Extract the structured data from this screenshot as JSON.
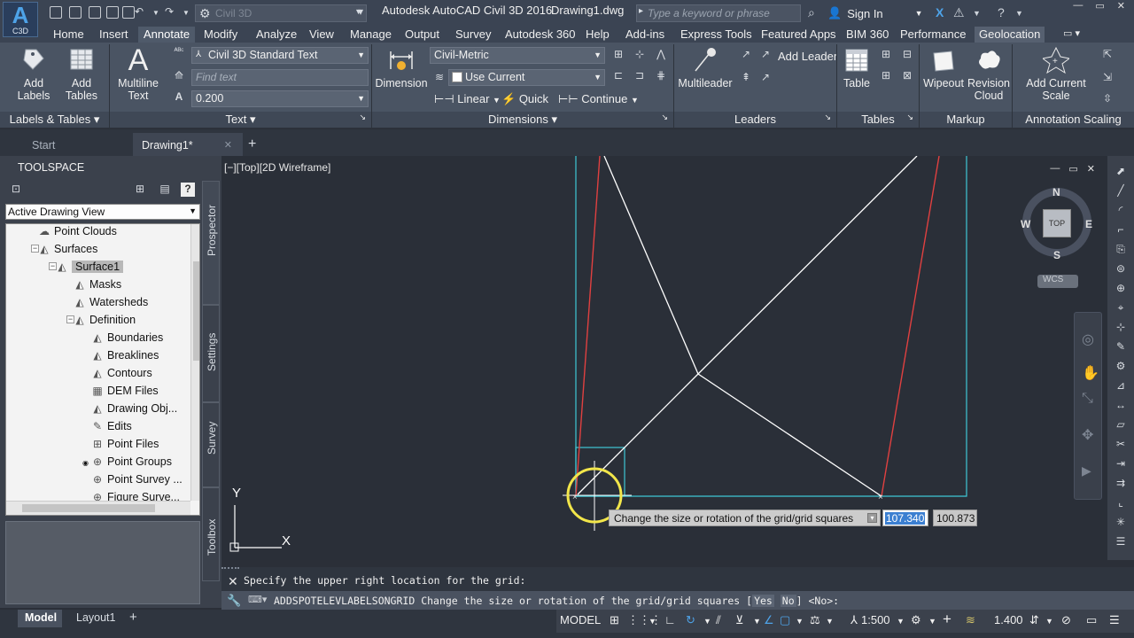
{
  "titlebar": {
    "app_title": "Autodesk AutoCAD Civil 3D 2016",
    "doc_title": "Drawing1.dwg",
    "workspace": "Civil 3D",
    "search_placeholder": "Type a keyword or phrase",
    "signin": "Sign In",
    "logo_letter": "A",
    "logo_sub": "C3D"
  },
  "ribbon_tabs": [
    "Home",
    "Insert",
    "Annotate",
    "Modify",
    "Analyze",
    "View",
    "Manage",
    "Output",
    "Survey",
    "Autodesk 360",
    "Help",
    "Add-ins",
    "Express Tools",
    "Featured Apps",
    "BIM 360",
    "Performance",
    "Geolocation"
  ],
  "active_ribbon_tab": "Annotate",
  "ribbon": {
    "labels_tables": {
      "title": "Labels & Tables",
      "add_labels": "Add Labels",
      "add_tables": "Add Tables"
    },
    "text": {
      "title": "Text",
      "multiline": "Multiline Text",
      "style": "Civil 3D Standard Text",
      "find_placeholder": "Find text",
      "height": "0.200"
    },
    "dimensions": {
      "title": "Dimensions",
      "dimension": "Dimension",
      "style": "Civil-Metric",
      "layer": "Use Current",
      "linear": "Linear",
      "quick": "Quick",
      "continue": "Continue"
    },
    "leaders": {
      "title": "Leaders",
      "multileader": "Multileader",
      "add_leader": "Add Leader"
    },
    "tables": {
      "title": "Tables",
      "table": "Table"
    },
    "markup": {
      "title": "Markup",
      "wipeout": "Wipeout",
      "revision_cloud": "Revision Cloud"
    },
    "annotation_scaling": {
      "title": "Annotation Scaling",
      "add_scale": "Add Current Scale"
    }
  },
  "doc_tabs": {
    "start": "Start",
    "drawing": "Drawing1*"
  },
  "toolspace": {
    "title": "TOOLSPACE",
    "view": "Active Drawing View",
    "tree": [
      {
        "label": "Point Clouds",
        "level": 2,
        "icon": "point-cloud-icon"
      },
      {
        "label": "Surfaces",
        "level": 2,
        "icon": "surfaces-icon"
      },
      {
        "label": "Surface1",
        "level": 3,
        "icon": "surface-icon",
        "selected": true
      },
      {
        "label": "Masks",
        "level": 4,
        "icon": "masks-icon"
      },
      {
        "label": "Watersheds",
        "level": 4,
        "icon": "watersheds-icon"
      },
      {
        "label": "Definition",
        "level": 4,
        "icon": "definition-icon"
      },
      {
        "label": "Boundaries",
        "level": 5,
        "icon": "boundaries-icon"
      },
      {
        "label": "Breaklines",
        "level": 5,
        "icon": "breaklines-icon"
      },
      {
        "label": "Contours",
        "level": 5,
        "icon": "contours-icon"
      },
      {
        "label": "DEM Files",
        "level": 5,
        "icon": "dem-files-icon"
      },
      {
        "label": "Drawing Obj...",
        "level": 5,
        "icon": "drawing-objects-icon"
      },
      {
        "label": "Edits",
        "level": 5,
        "icon": "edits-icon"
      },
      {
        "label": "Point Files",
        "level": 5,
        "icon": "point-files-icon"
      },
      {
        "label": "Point Groups",
        "level": 5,
        "icon": "point-groups-icon"
      },
      {
        "label": "Point Survey ...",
        "level": 5,
        "icon": "point-survey-icon"
      },
      {
        "label": "Figure Surve...",
        "level": 5,
        "icon": "figure-survey-icon"
      }
    ],
    "side_tabs": [
      "Prospector",
      "Settings",
      "Survey",
      "Toolbox"
    ]
  },
  "viewport": {
    "label": "[−][Top][2D Wireframe]",
    "compass": {
      "n": "N",
      "s": "S",
      "e": "E",
      "w": "W",
      "top": "TOP",
      "wcs": "WCS"
    },
    "ucs_x": "X",
    "ucs_y": "Y",
    "tooltip": "Change the size or rotation of the grid/grid squares",
    "coord_x": "107.340",
    "coord_y": "100.873"
  },
  "command": {
    "history": "Specify the upper right location for the grid:",
    "prompt_cmd": "ADDSPOTELEVLABELSONGRID",
    "prompt_text": "Change the size or rotation of the grid/grid squares [",
    "opt_yes": "Yes",
    "opt_no": "No",
    "prompt_end": "] <No>:"
  },
  "status": {
    "model_tab": "Model",
    "layout_tab": "Layout1",
    "space": "MODEL",
    "scale": "1:500",
    "lineweight": "1.400"
  },
  "colors": {
    "cyan_line": "#3fc8d6",
    "red_line": "#e04040",
    "white_line": "#ffffff",
    "cursor_ring": "#f2e64a"
  }
}
